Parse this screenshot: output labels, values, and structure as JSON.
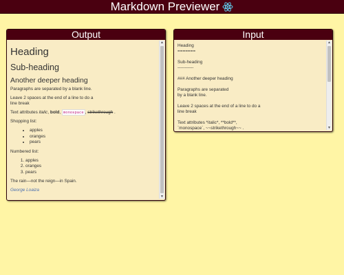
{
  "app": {
    "title": "Markdown Previewer",
    "logo_icon": "react-icon",
    "brand_color": "#4a0010",
    "background_color": "#fff5a5",
    "panel_color": "#f9ecc5"
  },
  "output": {
    "header": "Output",
    "h1": "Heading",
    "h2": "Sub-heading",
    "h3": "Another deeper heading",
    "p1": "Paragraphs are separated by a blank line.",
    "p2_line1": "Leave 2 spaces at the end of a line to do a",
    "p2_line2": "line break",
    "attr_prefix": "Text attributes ",
    "attr_italic": "italic",
    "attr_sep1": ", ",
    "attr_bold": "bold",
    "attr_sep2": ", ",
    "attr_mono": "monospace",
    "attr_sep3": ", ",
    "attr_strike": "strikethrough",
    "attr_end": " .",
    "shopping_label": "Shopping list:",
    "shopping": [
      "apples",
      "oranges",
      "pears"
    ],
    "numbered_label": "Numbered list:",
    "numbered": [
      "apples",
      "oranges",
      "pears"
    ],
    "quote": "The rain—not the reign—in Spain.",
    "author": "George Loaiza"
  },
  "input": {
    "header": "Input",
    "text": "Heading\n=======\n\nSub-heading\n-----------\n\n### Another deeper heading\n\nParagraphs are separated\nby a blank line.\n\nLeave 2 spaces at the end of a line to do a\nline break\n\nText attributes *italic*, **bold**,\n`monospace`, ~~strikethrough~~ ."
  }
}
